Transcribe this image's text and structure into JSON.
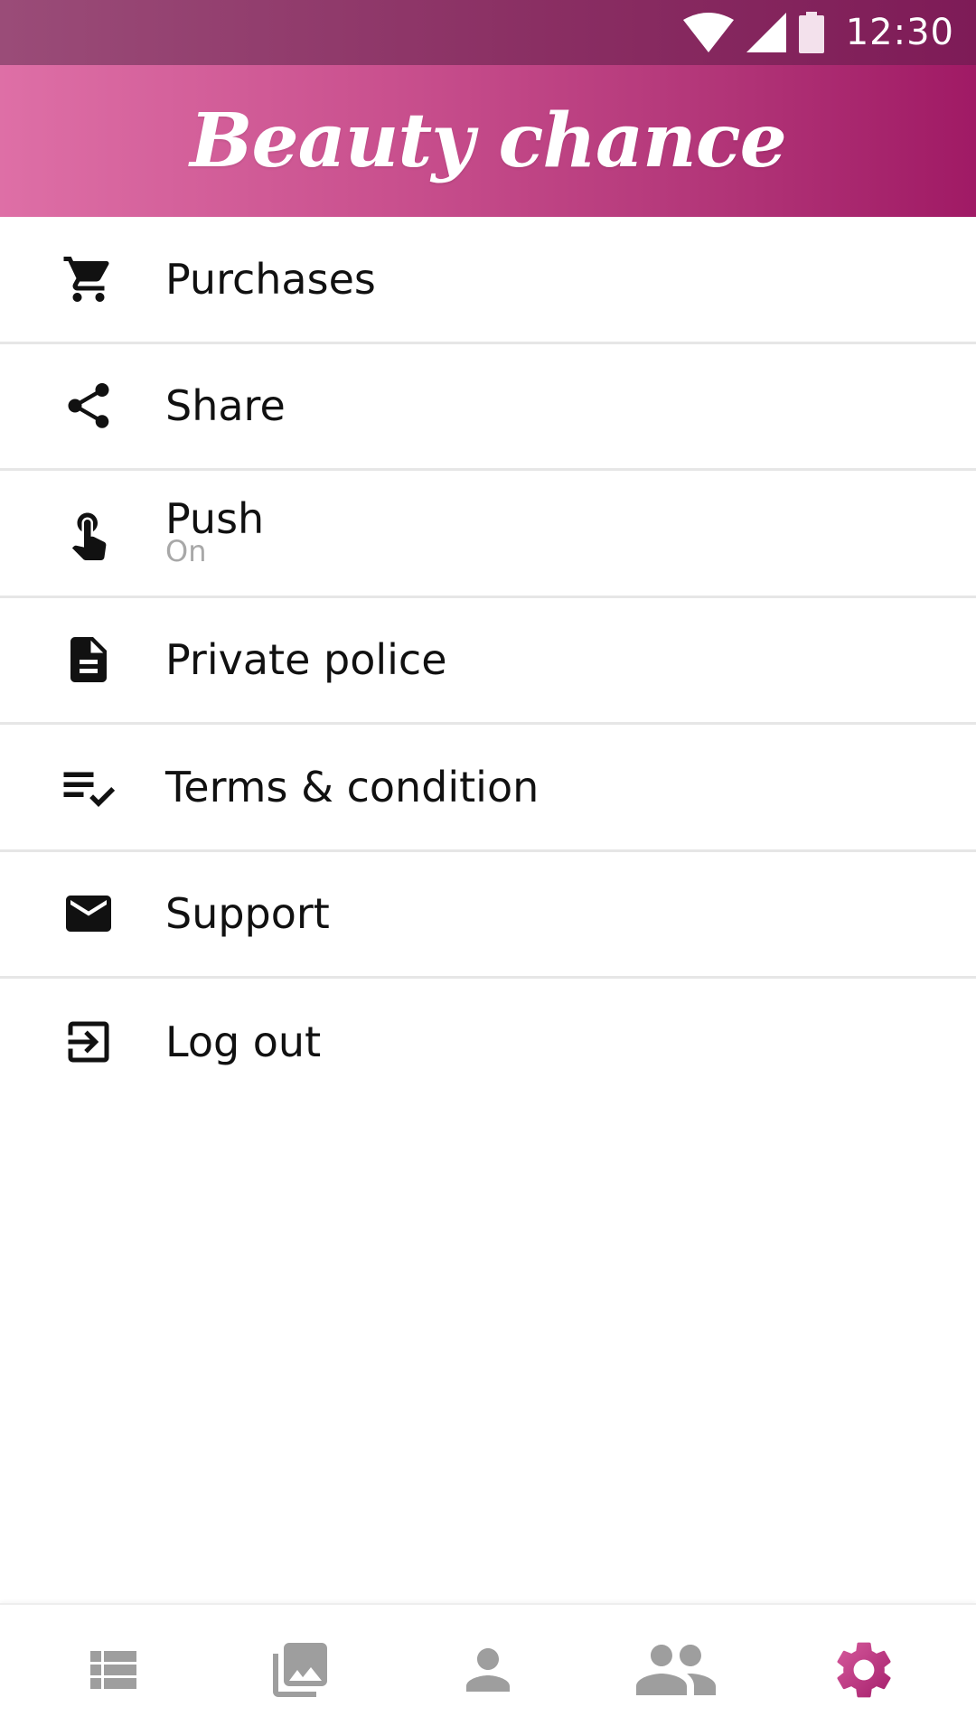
{
  "status_bar": {
    "time": "12:30",
    "icons": [
      "wifi-icon",
      "cell-signal-icon",
      "battery-icon"
    ]
  },
  "header": {
    "title": "Beauty chance",
    "gradient_start": "#de6fa6",
    "gradient_end": "#a01a65"
  },
  "menu": {
    "items": [
      {
        "label": "Purchases",
        "icon": "cart-icon"
      },
      {
        "label": "Share",
        "icon": "share-icon"
      },
      {
        "label": "Push",
        "sublabel": "On",
        "icon": "touch-icon"
      },
      {
        "label": "Private police",
        "icon": "document-icon"
      },
      {
        "label": "Terms & condition",
        "icon": "checklist-icon"
      },
      {
        "label": "Support",
        "icon": "mail-icon"
      },
      {
        "label": "Log out",
        "icon": "logout-icon"
      }
    ]
  },
  "bottom_nav": {
    "items": [
      {
        "name": "list",
        "icon": "list-icon",
        "active": false
      },
      {
        "name": "gallery",
        "icon": "photo-library-icon",
        "active": false
      },
      {
        "name": "profile",
        "icon": "person-icon",
        "active": false
      },
      {
        "name": "people",
        "icon": "people-icon",
        "active": false
      },
      {
        "name": "settings",
        "icon": "gear-icon",
        "active": true
      }
    ],
    "inactive_color": "#9e9e9e",
    "active_color": "#c2397f"
  }
}
